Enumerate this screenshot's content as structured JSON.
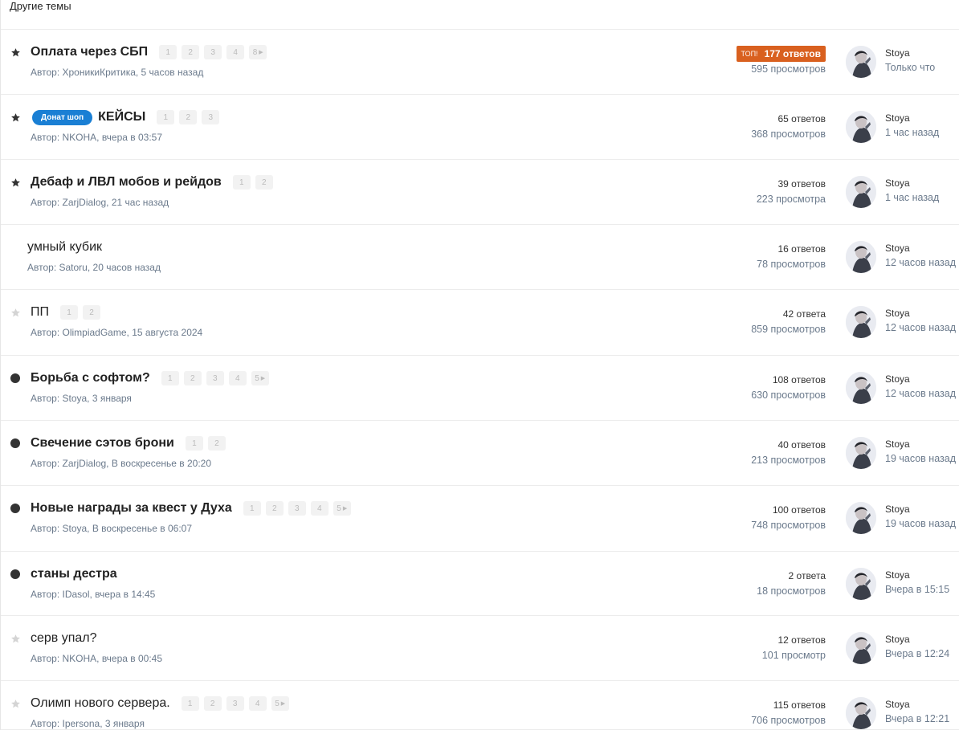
{
  "section_title": "Другие темы",
  "topics": [
    {
      "marker": "star-filled",
      "title": "Оплата через СБП",
      "bold": true,
      "tag": "",
      "pages": [
        "1",
        "2",
        "3",
        "4",
        "8"
      ],
      "pages_last_arrow": true,
      "author": "Автор: ХроникиКритика, 5 часов назад",
      "hot_label": "ТОП!",
      "replies": "177 ответов",
      "views": "595 просмотров",
      "last_user": "Stoya",
      "last_time": "Только что"
    },
    {
      "marker": "star-filled",
      "title": "КЕЙСЫ",
      "bold": true,
      "tag": "Донат шоп",
      "pages": [
        "1",
        "2",
        "3"
      ],
      "pages_last_arrow": false,
      "author": "Автор: NKOHA, вчера в 03:57",
      "hot_label": "",
      "replies": "65 ответов",
      "views": "368 просмотров",
      "last_user": "Stoya",
      "last_time": "1 час назад"
    },
    {
      "marker": "star-filled",
      "title": "Дебаф и ЛВЛ мобов и рейдов",
      "bold": true,
      "tag": "",
      "pages": [
        "1",
        "2"
      ],
      "pages_last_arrow": false,
      "author": "Автор: ZarjDialog, 21 час назад",
      "hot_label": "",
      "replies": "39 ответов",
      "views": "223 просмотра",
      "last_user": "Stoya",
      "last_time": "1 час назад"
    },
    {
      "marker": "none",
      "title": "умный кубик",
      "bold": false,
      "tag": "",
      "pages": [],
      "pages_last_arrow": false,
      "author": "Автор: Satoru, 20 часов назад",
      "hot_label": "",
      "replies": "16 ответов",
      "views": "78 просмотров",
      "last_user": "Stoya",
      "last_time": "12 часов назад"
    },
    {
      "marker": "star-empty",
      "title": "ПП",
      "bold": false,
      "tag": "",
      "pages": [
        "1",
        "2"
      ],
      "pages_last_arrow": false,
      "author": "Автор: OlimpiadGame, 15 августа 2024",
      "hot_label": "",
      "replies": "42 ответа",
      "views": "859 просмотров",
      "last_user": "Stoya",
      "last_time": "12 часов назад"
    },
    {
      "marker": "dot",
      "title": "Борьба с софтом?",
      "bold": true,
      "tag": "",
      "pages": [
        "1",
        "2",
        "3",
        "4",
        "5"
      ],
      "pages_last_arrow": true,
      "author": "Автор: Stoya, 3 января",
      "hot_label": "",
      "replies": "108 ответов",
      "views": "630 просмотров",
      "last_user": "Stoya",
      "last_time": "12 часов назад"
    },
    {
      "marker": "dot",
      "title": "Свечение сэтов брони",
      "bold": true,
      "tag": "",
      "pages": [
        "1",
        "2"
      ],
      "pages_last_arrow": false,
      "author": "Автор: ZarjDialog, В воскресенье в 20:20",
      "hot_label": "",
      "replies": "40 ответов",
      "views": "213 просмотров",
      "last_user": "Stoya",
      "last_time": "19 часов назад"
    },
    {
      "marker": "dot",
      "title": "Новые награды за квест у Духа",
      "bold": true,
      "tag": "",
      "pages": [
        "1",
        "2",
        "3",
        "4",
        "5"
      ],
      "pages_last_arrow": true,
      "author": "Автор: Stoya, В воскресенье в 06:07",
      "hot_label": "",
      "replies": "100 ответов",
      "views": "748 просмотров",
      "last_user": "Stoya",
      "last_time": "19 часов назад"
    },
    {
      "marker": "dot",
      "title": "станы дестра",
      "bold": true,
      "tag": "",
      "pages": [],
      "pages_last_arrow": false,
      "author": "Автор: IDasol, вчера в 14:45",
      "hot_label": "",
      "replies": "2 ответа",
      "views": "18 просмотров",
      "last_user": "Stoya",
      "last_time": "Вчера в 15:15"
    },
    {
      "marker": "star-empty",
      "title": "серв упал?",
      "bold": false,
      "tag": "",
      "pages": [],
      "pages_last_arrow": false,
      "author": "Автор: NKOHA, вчера в 00:45",
      "hot_label": "",
      "replies": "12 ответов",
      "views": "101 просмотр",
      "last_user": "Stoya",
      "last_time": "Вчера в 12:24"
    },
    {
      "marker": "star-empty",
      "title": "Олимп нового сервера.",
      "bold": false,
      "tag": "",
      "pages": [
        "1",
        "2",
        "3",
        "4",
        "5"
      ],
      "pages_last_arrow": true,
      "author": "Автор: Ipersona, 3 января",
      "hot_label": "",
      "replies": "115 ответов",
      "views": "706 просмотров",
      "last_user": "Stoya",
      "last_time": "Вчера в 12:21"
    }
  ],
  "colors": {
    "hot": "#d9601f",
    "tag": "#1a7fd4",
    "muted": "#6b7a8c"
  }
}
